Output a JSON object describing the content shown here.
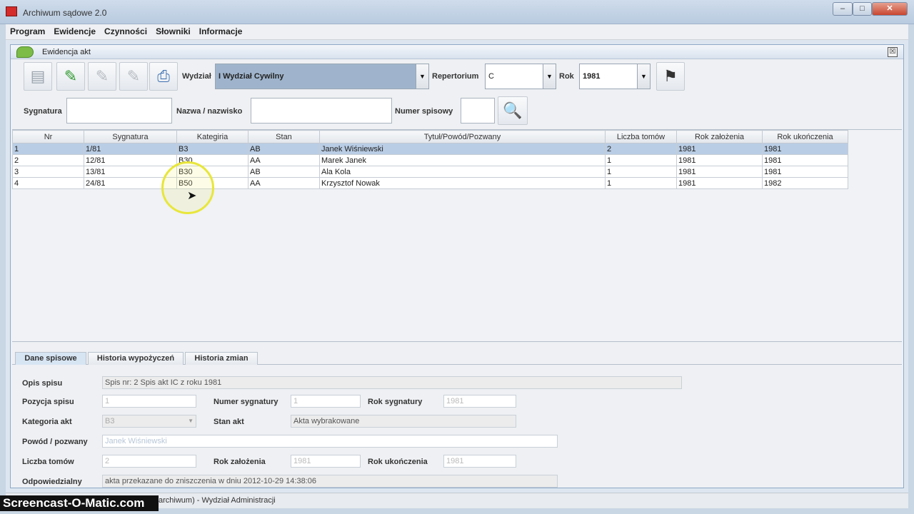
{
  "window": {
    "title": "Archiwum sądowe 2.0",
    "min": "–",
    "max": "□",
    "close": "✕"
  },
  "menu": [
    "Program",
    "Ewidencje",
    "Czynności",
    "Słowniki",
    "Informacje"
  ],
  "frame": {
    "title": "Ewidencja akt",
    "close": "☒"
  },
  "toolbar": {
    "wydzial_label": "Wydział",
    "wydzial_value": "I Wydział Cywilny",
    "repertorium_label": "Repertorium",
    "repertorium_value": "C",
    "rok_label": "Rok",
    "rok_value": "1981"
  },
  "search": {
    "sygnatura_label": "Sygnatura",
    "nazwa_label": "Nazwa / nazwisko",
    "numer_label": "Numer spisowy"
  },
  "table": {
    "columns": [
      "Nr",
      "Sygnatura",
      "Kategiria",
      "Stan",
      "Tytuł/Powód/Pozwany",
      "Liczba tomów",
      "Rok założenia",
      "Rok ukończenia"
    ],
    "rows": [
      [
        "1",
        "1/81",
        "B3",
        "AB",
        "Janek Wiśniewski",
        "2",
        "1981",
        "1981"
      ],
      [
        "2",
        "12/81",
        "B30",
        "AA",
        "Marek Janek",
        "1",
        "1981",
        "1981"
      ],
      [
        "3",
        "13/81",
        "B30",
        "AB",
        "Ala Kola",
        "1",
        "1981",
        "1981"
      ],
      [
        "4",
        "24/81",
        "B50",
        "AA",
        "Krzysztof Nowak",
        "1",
        "1981",
        "1982"
      ]
    ]
  },
  "tabs": [
    "Dane spisowe",
    "Historia wypożyczeń",
    "Historia zmian"
  ],
  "details": {
    "opis_label": "Opis spisu",
    "opis_value": "Spis nr: 2 Spis akt IC z roku 1981",
    "pozycja_label": "Pozycja spisu",
    "pozycja_value": "1",
    "numer_syg_label": "Numer sygnatury",
    "numer_syg_value": "1",
    "rok_syg_label": "Rok sygnatury",
    "rok_syg_value": "1981",
    "kategoria_label": "Kategoria akt",
    "kategoria_value": "B3",
    "stan_label": "Stan akt",
    "stan_value": "Akta wybrakowane",
    "powod_label": "Powód / pozwany",
    "powod_value": "Janek Wiśniewski",
    "tomy_label": "Liczba tomów",
    "tomy_value": "2",
    "rok_zal_label": "Rok założenia",
    "rok_zal_value": "1981",
    "rok_uk_label": "Rok ukończenia",
    "rok_uk_value": "1981",
    "odp_label": "Odpowiedzialny",
    "odp_value": "akta przekazane do zniszczenia w dniu 2012-10-29 14:38:06"
  },
  "status": {
    "text": "archiwum) - Wydział Administracji"
  },
  "watermark": "Screencast-O-Matic.com"
}
